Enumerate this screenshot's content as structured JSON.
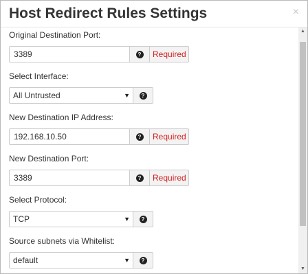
{
  "dialog": {
    "title": "Host Redirect Rules Settings",
    "close_glyph": "×"
  },
  "help_glyph": "?",
  "fields": {
    "original_port": {
      "label": "Original Destination Port:",
      "value": "3389",
      "required": "Required"
    },
    "interface": {
      "label": "Select Interface:",
      "value": "All Untrusted"
    },
    "new_ip": {
      "label": "New Destination IP Address:",
      "value": "192.168.10.50",
      "required": "Required"
    },
    "new_port": {
      "label": "New Destination Port:",
      "value": "3389",
      "required": "Required"
    },
    "protocol": {
      "label": "Select Protocol:",
      "value": "TCP"
    },
    "whitelist": {
      "label": "Source subnets via Whitelist:",
      "value": "default"
    }
  },
  "icons": {
    "caret": "▼",
    "scroll_up": "▲",
    "scroll_down": "▼"
  },
  "colors": {
    "required_text": "#d21f1f"
  }
}
